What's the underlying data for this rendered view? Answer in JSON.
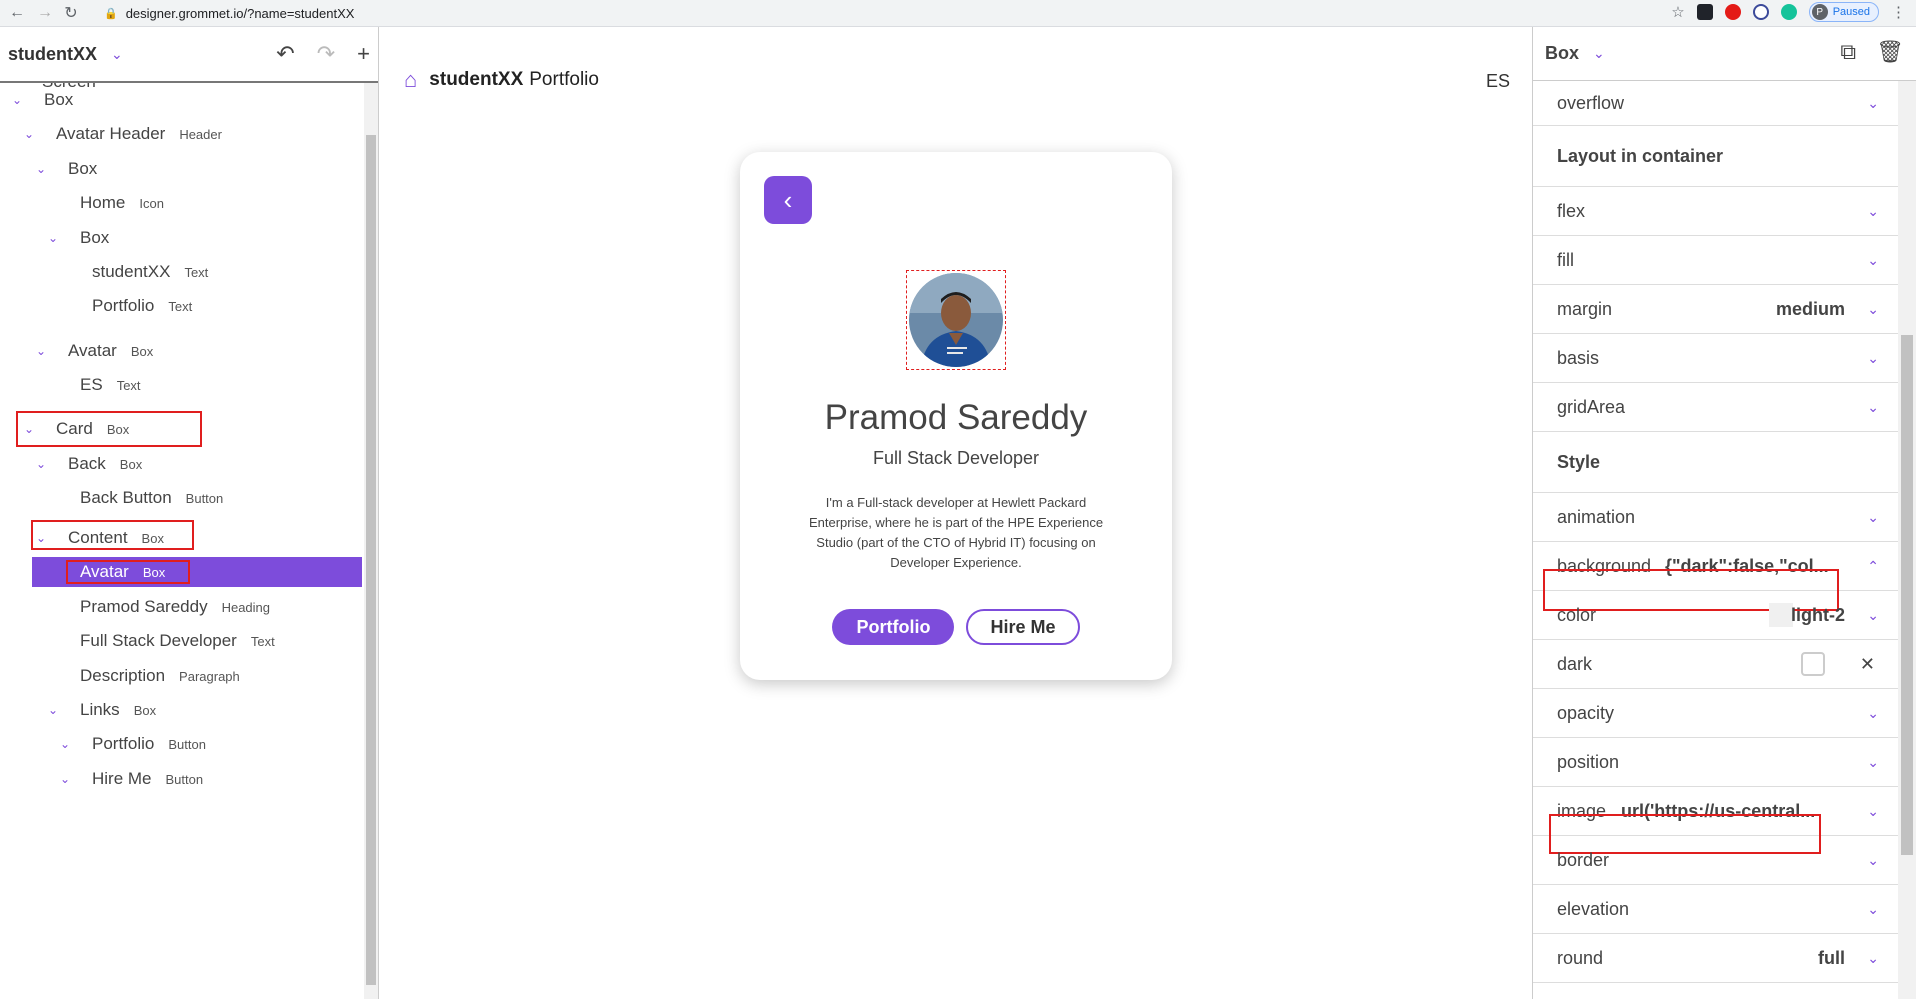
{
  "browser": {
    "url": "designer.grommet.io/?name=studentXX",
    "profile_initial": "P",
    "profile_status": "Paused"
  },
  "left_panel": {
    "title": "studentXX",
    "tree": [
      {
        "label": "Screen",
        "type": ""
      },
      {
        "label": "Box",
        "type": ""
      },
      {
        "label": "Avatar Header",
        "type": "Header"
      },
      {
        "label": "Box",
        "type": ""
      },
      {
        "label": "Home",
        "type": "Icon"
      },
      {
        "label": "Box",
        "type": ""
      },
      {
        "label": "studentXX",
        "type": "Text"
      },
      {
        "label": "Portfolio",
        "type": "Text"
      },
      {
        "label": "Avatar",
        "type": "Box"
      },
      {
        "label": "ES",
        "type": "Text"
      },
      {
        "label": "Card",
        "type": "Box"
      },
      {
        "label": "Back",
        "type": "Box"
      },
      {
        "label": "Back Button",
        "type": "Button"
      },
      {
        "label": "Content",
        "type": "Box"
      },
      {
        "label": "Avatar",
        "type": "Box"
      },
      {
        "label": "Pramod Sareddy",
        "type": "Heading"
      },
      {
        "label": "Full Stack Developer",
        "type": "Text"
      },
      {
        "label": "Description",
        "type": "Paragraph"
      },
      {
        "label": "Links",
        "type": "Box"
      },
      {
        "label": "Portfolio",
        "type": "Button"
      },
      {
        "label": "Hire Me",
        "type": "Button"
      }
    ]
  },
  "canvas": {
    "header_brand": "studentXX",
    "header_sub": "Portfolio",
    "header_avatar": "ES",
    "card": {
      "name": "Pramod Sareddy",
      "role": "Full Stack Developer",
      "description": "I'm a Full-stack developer at Hewlett Packard Enterprise, where he is part of the HPE Experience Studio (part of the CTO of Hybrid IT) focusing on Developer Experience.",
      "primary_button": "Portfolio",
      "secondary_button": "Hire Me"
    }
  },
  "right_panel": {
    "title": "Box",
    "rows": [
      {
        "label": "overflow",
        "value": ""
      },
      {
        "label": "Layout in container",
        "section": true
      },
      {
        "label": "flex",
        "value": ""
      },
      {
        "label": "fill",
        "value": ""
      },
      {
        "label": "margin",
        "value": "medium"
      },
      {
        "label": "basis",
        "value": ""
      },
      {
        "label": "gridArea",
        "value": ""
      },
      {
        "label": "Style",
        "section": true
      },
      {
        "label": "animation",
        "value": ""
      },
      {
        "label": "background",
        "value": "{\"dark\":false,\"col..."
      },
      {
        "label": "color",
        "value": "light-2"
      },
      {
        "label": "dark",
        "value": ""
      },
      {
        "label": "opacity",
        "value": ""
      },
      {
        "label": "position",
        "value": ""
      },
      {
        "label": "image",
        "value": "url('https://us-central..."
      },
      {
        "label": "border",
        "value": ""
      },
      {
        "label": "elevation",
        "value": ""
      },
      {
        "label": "round",
        "value": "full"
      }
    ]
  },
  "colors": {
    "accent": "#7d4cdb",
    "highlight": "#e01e1e"
  }
}
